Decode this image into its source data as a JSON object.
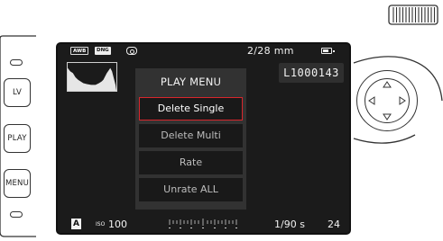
{
  "camera": {
    "buttons": [
      {
        "id": "lv",
        "label": "LV"
      },
      {
        "id": "play",
        "label": "PLAY"
      },
      {
        "id": "menu",
        "label": "MENU"
      }
    ]
  },
  "screen": {
    "status_top": {
      "awb_badge": "AWB",
      "format_badge": "DNG",
      "metering_icon": "center-weighted-metering-icon",
      "lens": "2/28 mm",
      "battery_icon": "battery-icon"
    },
    "file_number": "L1000143",
    "menu": {
      "title": "PLAY MENU",
      "selected_index": 0,
      "items": [
        "Delete Single",
        "Delete Multi",
        "Rate",
        "Unrate ALL"
      ]
    },
    "status_bottom": {
      "mode": "A",
      "iso_label": "ISO",
      "iso_value": "100",
      "shutter": "1/90 s",
      "remaining": "24"
    }
  },
  "colors": {
    "screen_bg": "#1b1b1b",
    "menu_bg": "#323232",
    "item_bg": "#191919",
    "selected_border": "#d8262c"
  }
}
